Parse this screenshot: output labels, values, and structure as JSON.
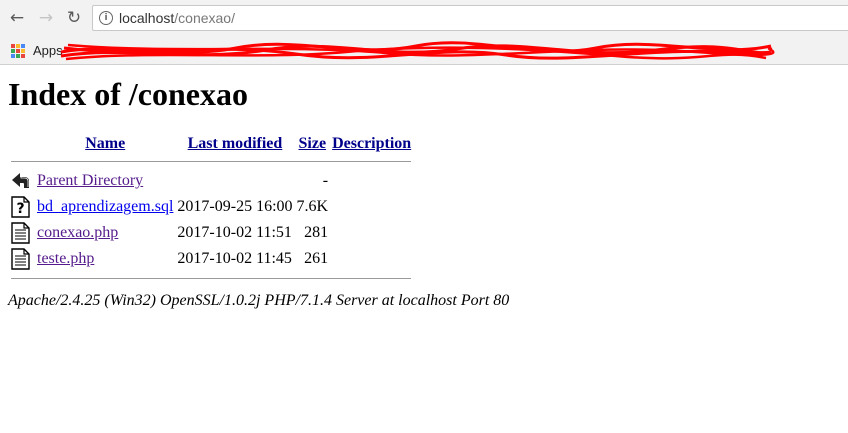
{
  "browser": {
    "url_host": "localhost",
    "url_path": "/conexao/",
    "bookmarks": {
      "apps_label": "Apps"
    }
  },
  "page": {
    "title": "Index of /conexao",
    "columns": {
      "name": "Name",
      "last_modified": "Last modified",
      "size": "Size",
      "description": "Description"
    },
    "parent": {
      "name": "Parent Directory",
      "size": "-"
    },
    "files": [
      {
        "icon": "unknown-file-icon",
        "name": "bd_aprendizagem.sql",
        "last_modified": "2017-09-25 16:00",
        "size": "7.6K"
      },
      {
        "icon": "text-file-icon",
        "name": "conexao.php",
        "last_modified": "2017-10-02 11:51",
        "size": "281"
      },
      {
        "icon": "text-file-icon",
        "name": "teste.php",
        "last_modified": "2017-10-02 11:45",
        "size": "261"
      }
    ],
    "footer": "Apache/2.4.25 (Win32) OpenSSL/1.0.2j PHP/7.1.4 Server at localhost Port 80"
  },
  "colors": {
    "link_visited": "#551a8b",
    "link_unvisited": "#0000ee",
    "redaction": "#ff0000"
  }
}
